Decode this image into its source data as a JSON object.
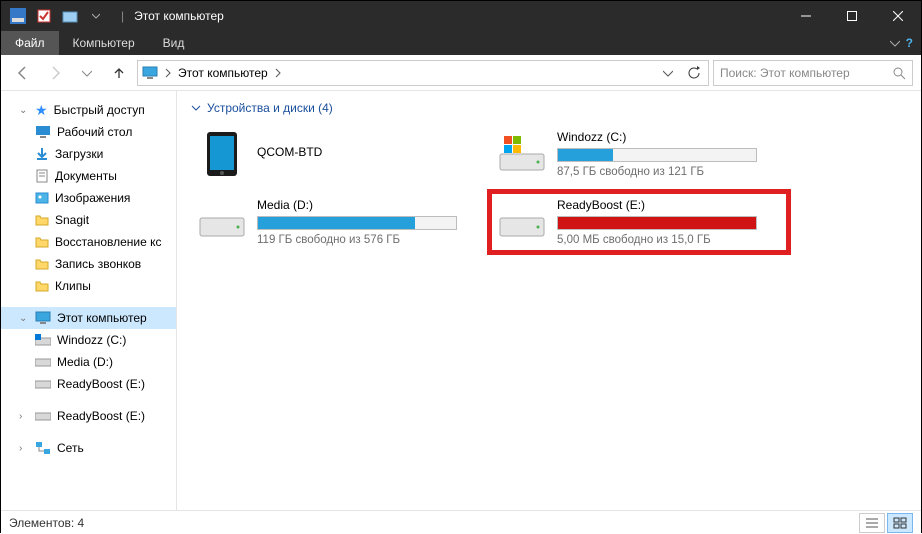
{
  "window": {
    "title": "Этот компьютер"
  },
  "menubar": {
    "file": "Файл",
    "computer": "Компьютер",
    "view": "Вид"
  },
  "nav": {
    "breadcrumb": "Этот компьютер",
    "search_placeholder": "Поиск: Этот компьютер"
  },
  "sidebar": {
    "quick_access": "Быстрый доступ",
    "items": [
      {
        "label": "Рабочий стол",
        "icon": "desktop"
      },
      {
        "label": "Загрузки",
        "icon": "downloads"
      },
      {
        "label": "Документы",
        "icon": "documents"
      },
      {
        "label": "Изображения",
        "icon": "pictures"
      },
      {
        "label": "Snagit",
        "icon": "folder"
      },
      {
        "label": "Восстановление кс",
        "icon": "folder"
      },
      {
        "label": "Запись звонков",
        "icon": "folder"
      },
      {
        "label": "Клипы",
        "icon": "folder"
      }
    ],
    "this_pc": "Этот компьютер",
    "drives": [
      {
        "label": "Windozz (C:)",
        "icon": "drive-os"
      },
      {
        "label": "Media (D:)",
        "icon": "drive"
      },
      {
        "label": "ReadyBoost (E:)",
        "icon": "drive"
      }
    ],
    "readyboost": "ReadyBoost (E:)",
    "network": "Сеть"
  },
  "group": {
    "header": "Устройства и диски (4)"
  },
  "devices": [
    {
      "name": "QCOM-BTD",
      "type": "phone",
      "sub": "",
      "has_bar": false
    },
    {
      "name": "Windozz (C:)",
      "type": "drive-os",
      "sub": "87,5 ГБ свободно из 121 ГБ",
      "has_bar": true,
      "fill_pct": 27.7,
      "fill_color": "#26a0da"
    },
    {
      "name": "Media (D:)",
      "type": "drive",
      "sub": "119 ГБ свободно из 576 ГБ",
      "has_bar": true,
      "fill_pct": 79.3,
      "fill_color": "#26a0da"
    },
    {
      "name": "ReadyBoost (E:)",
      "type": "drive",
      "sub": "5,00 МБ свободно из 15,0 ГБ",
      "has_bar": true,
      "fill_pct": 99.97,
      "fill_color": "#d01414",
      "highlight": true
    }
  ],
  "status": {
    "elements": "Элементов: 4"
  }
}
